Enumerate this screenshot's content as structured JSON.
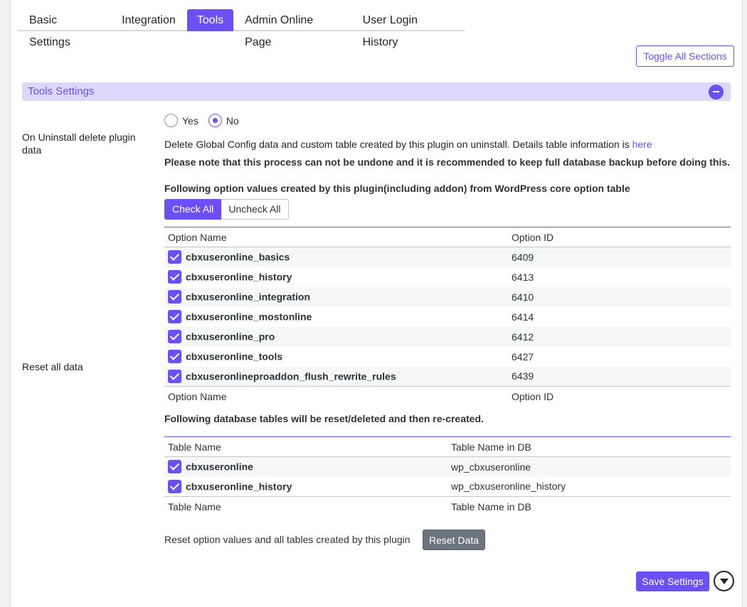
{
  "tabs": [
    "Basic Settings",
    "Integration",
    "Tools",
    "Admin Online Page",
    "User Login History"
  ],
  "toggle_all_label": "Toggle All Sections",
  "section_title": "Tools Settings",
  "uninstall": {
    "label": "On Uninstall delete plugin data",
    "yes_label": "Yes",
    "no_label": "No",
    "selected": "No",
    "description": "Delete Global Config data and custom table created by this plugin on uninstall. Details table information is ",
    "link_text": "here",
    "warning": "Please note that this process can not be undone and it is recommended to keep full database backup before doing this."
  },
  "reset": {
    "label": "Reset all data",
    "options_heading": "Following option values created by this plugin(including addon) from WordPress core option table",
    "check_all": "Check All",
    "uncheck_all": "Uncheck All",
    "options_columns": [
      "Option Name",
      "Option ID"
    ],
    "options": [
      {
        "name": "cbxuseronline_basics",
        "id": "6409",
        "checked": true
      },
      {
        "name": "cbxuseronline_history",
        "id": "6413",
        "checked": true
      },
      {
        "name": "cbxuseronline_integration",
        "id": "6410",
        "checked": true
      },
      {
        "name": "cbxuseronline_mostonline",
        "id": "6414",
        "checked": true
      },
      {
        "name": "cbxuseronline_pro",
        "id": "6412",
        "checked": true
      },
      {
        "name": "cbxuseronline_tools",
        "id": "6427",
        "checked": true
      },
      {
        "name": "cbxuseronlineproaddon_flush_rewrite_rules",
        "id": "6439",
        "checked": true
      }
    ],
    "tables_heading": "Following database tables will be reset/deleted and then re-created.",
    "tables_columns": [
      "Table Name",
      "Table Name in DB"
    ],
    "tables": [
      {
        "name": "cbxuseronline",
        "db": "wp_cbxuseronline",
        "checked": true
      },
      {
        "name": "cbxuseronline_history",
        "db": "wp_cbxuseronline_history",
        "checked": true
      }
    ],
    "reset_text": "Reset option values and all tables created by this plugin",
    "reset_button": "Reset Data"
  },
  "save_button": "Save Settings",
  "colors": {
    "accent": "#6c4ff6",
    "section_bg": "#dcd8fb",
    "reset_btn": "#6c757d"
  }
}
